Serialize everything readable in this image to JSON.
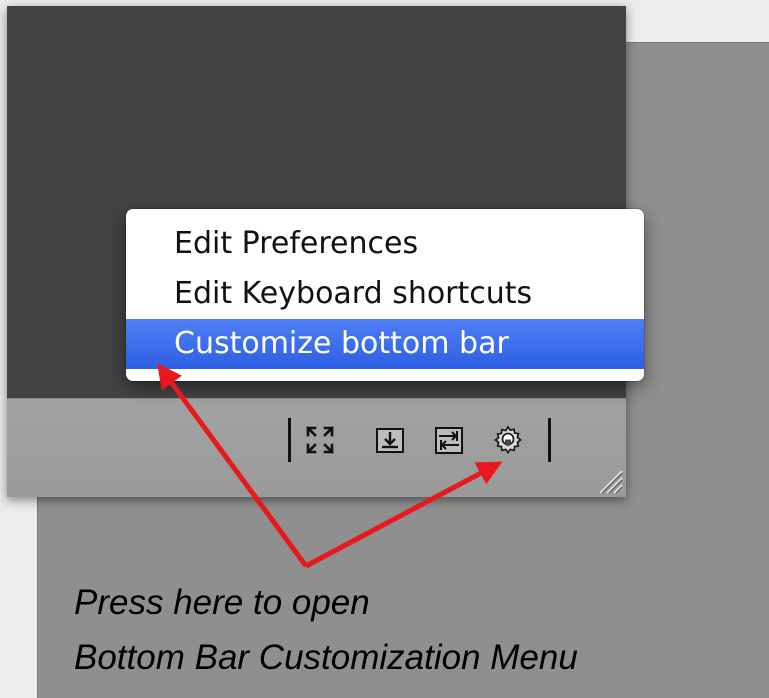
{
  "menu": {
    "items": [
      {
        "label": "Edit Preferences"
      },
      {
        "label": "Edit Keyboard shortcuts"
      },
      {
        "label": "Customize bottom bar",
        "selected": true
      }
    ]
  },
  "bottom_bar": {
    "buttons": [
      {
        "icon": "fullscreen-icon"
      },
      {
        "icon": "download-icon"
      },
      {
        "icon": "swap-icon"
      },
      {
        "icon": "gear-icon"
      }
    ]
  },
  "annotation": {
    "line1": "Press here to open",
    "line2": "Bottom Bar Customization Menu",
    "arrow_color": "#e8191c"
  },
  "colors": {
    "selection": "#3568ea",
    "window": "#434343",
    "bar": "#9e9e9e",
    "panel": "#8f8f8f"
  }
}
